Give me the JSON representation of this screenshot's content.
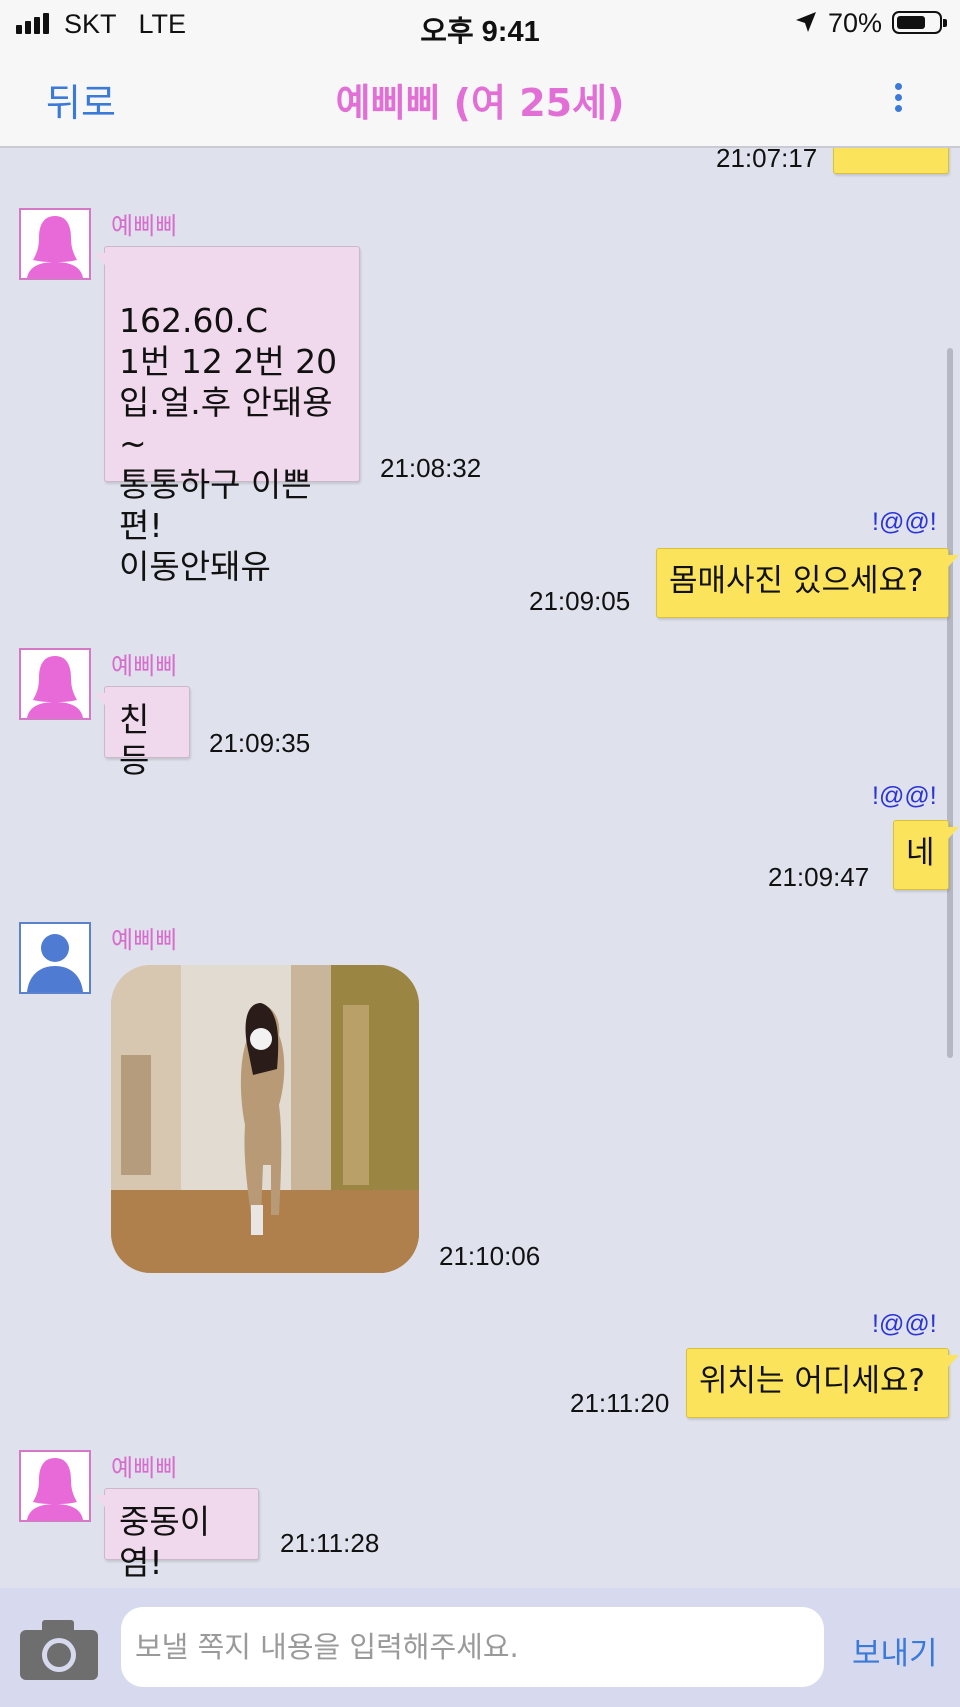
{
  "status_bar": {
    "carrier": "SKT   LTE",
    "time": "오후 9:41",
    "battery": "70%",
    "battery_level": 0.7,
    "icons": [
      "signal-icon",
      "location-icon",
      "battery-icon"
    ]
  },
  "header": {
    "back_label": "뒤로",
    "title": "예삐삐 (여 25세)",
    "more_icon": "more-vertical-icon",
    "accent": "#e26fd6",
    "link_color": "#3a7ad9"
  },
  "messages": [
    {
      "direction": "out",
      "time": "21:07:17",
      "text": "",
      "partial": true
    },
    {
      "direction": "in",
      "sender": "예삐삐",
      "avatar": "female-avatar-icon",
      "text": "162.60.C\n1번 12 2번 20\n입.얼.후 안돼용~\n통통하구 이쁜편!\n이동안돼유",
      "time": "21:08:32"
    },
    {
      "direction": "out",
      "sender": "!@@!",
      "text": "몸매사진 있으세요?",
      "time": "21:09:05"
    },
    {
      "direction": "in",
      "sender": "예삐삐",
      "avatar": "female-avatar-icon",
      "text": "친등",
      "time": "21:09:35"
    },
    {
      "direction": "out",
      "sender": "!@@!",
      "text": "네",
      "time": "21:09:47"
    },
    {
      "direction": "in",
      "sender": "예삐삐",
      "avatar": "male-avatar-icon",
      "image": "photo-message",
      "time": "21:10:06"
    },
    {
      "direction": "out",
      "sender": "!@@!",
      "text": "위치는 어디세요?",
      "time": "21:11:20"
    },
    {
      "direction": "in",
      "sender": "예삐삐",
      "avatar": "female-avatar-icon",
      "text": "중동이염!",
      "time": "21:11:28"
    }
  ],
  "composer": {
    "camera_icon": "camera-icon",
    "placeholder": "보낼 쪽지 내용을 입력해주세요.",
    "value": "",
    "send_label": "보내기"
  },
  "colors": {
    "background": "#dfe1ec",
    "incoming_bubble": "#f0d9ec",
    "outgoing_bubble": "#fbe35c",
    "self_name": "#2a34d8",
    "sender_name": "#d86ccc"
  }
}
